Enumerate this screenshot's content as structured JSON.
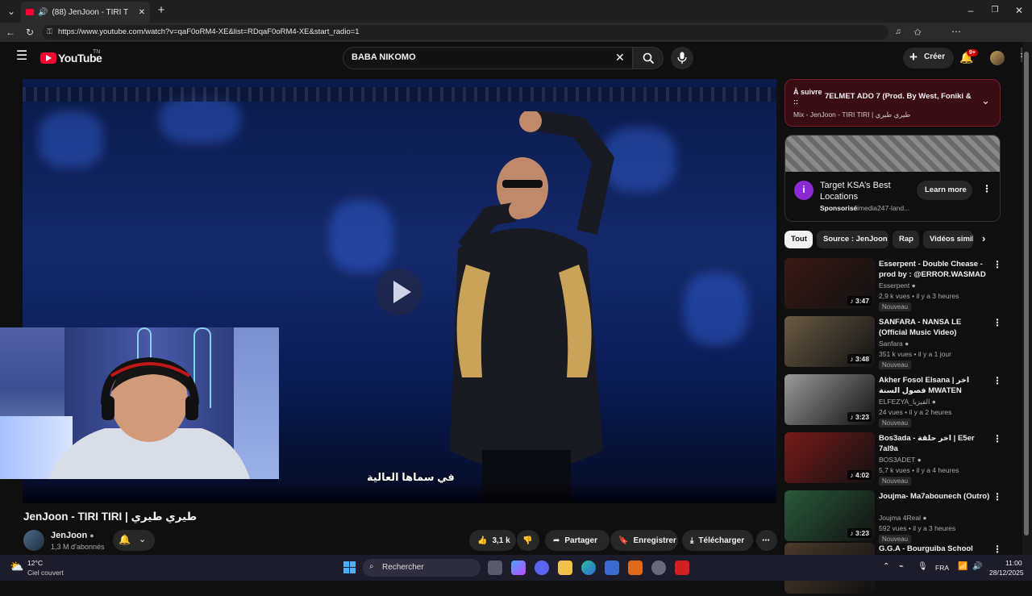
{
  "browser": {
    "tab_title": "(88) JenJoon - TIRI TIRI | طيري طيري",
    "url": "https://www.youtube.com/watch?v=qaF0oRM4-XE&list=RDqaF0oRM4-XE&start_radio=1",
    "copilot_label": "Conversation"
  },
  "header": {
    "logo_text": "YouTube",
    "region": "TN",
    "search_value": "BABA NIKOMO",
    "create_label": "Créer",
    "notif_badge": "9+"
  },
  "player": {
    "subtitle": "في سماها العالية"
  },
  "video": {
    "title": "JenJoon - TIRI TIRI | طيري طيري",
    "channel": "JenJoon",
    "subscribers": "1,3 M d’abonnés",
    "likes": "3,1 k",
    "share_label": "Partager",
    "save_label": "Enregistrer",
    "download_label": "Télécharger"
  },
  "up_next": {
    "label": "À suivre ::",
    "title": "7ELMET ADO 7 (Prod. By West, Foniki & Fl...",
    "mix": "Mix - JenJoon - TIRI TIRI | طيري طيري"
  },
  "ad": {
    "title": "Target KSA’s Best Locations",
    "sponsored": "Sponsorisé",
    "domain": "imedia247-land...",
    "cta": "Learn more"
  },
  "chips": [
    "Tout",
    "Source : JenJoon",
    "Rap",
    "Vidéos simil"
  ],
  "recommendations": [
    {
      "title": "Esserpent - Double Chease - prod by : @ERROR.WASMAD",
      "channel": "Esserpent",
      "views": "2,9 k vues",
      "age": "il y a 3 heures",
      "badge": "Nouveau",
      "duration": "3:47",
      "thumb_color": "#3a1a14"
    },
    {
      "title": "SANFARA - NANSA LE (Official Music Video)",
      "channel": "Sanfara",
      "views": "351 k vues",
      "age": "il y a 1 jour",
      "badge": "Nouveau",
      "duration": "3:48",
      "thumb_color": "#6a5a44"
    },
    {
      "title": "Akher Fosol Elsana | اخر فصول السنة MWATEN",
      "channel": "ELFEZYA_الفيزيا",
      "views": "24 vues",
      "age": "il y a 2 heures",
      "badge": "Nouveau",
      "duration": "3:23",
      "thumb_color": "#9a9a9a"
    },
    {
      "title": "Bos3ada - اخر حلقة | E5er 7al9a",
      "channel": "BOS3ADET",
      "views": "5,7 k vues",
      "age": "il y a 4 heures",
      "badge": "Nouveau",
      "duration": "4:02",
      "thumb_color": "#7a1a1a"
    },
    {
      "title": "Joujma- Ma7abounech (Outro)",
      "channel": "Joujma 4Real",
      "views": "592 vues",
      "age": "il y a 3 heures",
      "badge": "Nouveau",
      "duration": "3:23",
      "thumb_color": "#2a5a3a"
    },
    {
      "title": "G.G.A - Bourguiba School",
      "channel": "",
      "views": "",
      "age": "",
      "badge": "",
      "duration": "",
      "thumb_color": "#4a3a2a"
    }
  ],
  "taskbar": {
    "temp": "12°C",
    "weather": "Ciel couvert",
    "search_placeholder": "Rechercher",
    "lang": "FRA",
    "time": "11:00",
    "date": "28/12/2025"
  }
}
